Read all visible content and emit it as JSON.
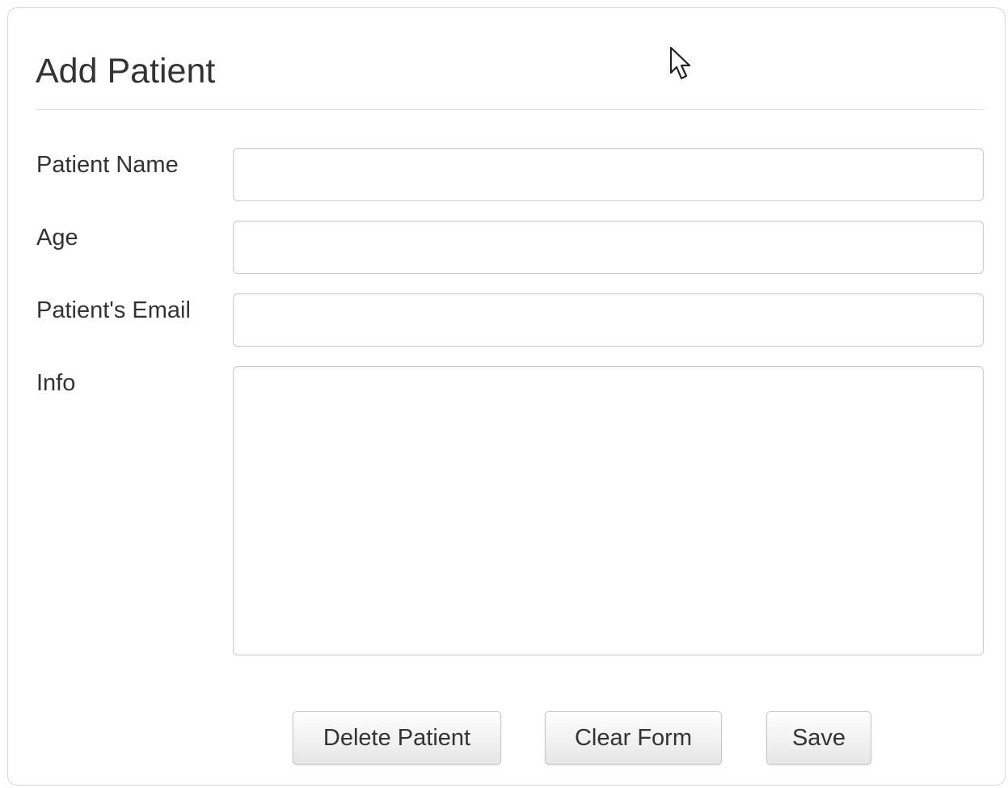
{
  "form": {
    "title": "Add Patient",
    "fields": [
      {
        "label": "Patient Name",
        "value": "",
        "placeholder": ""
      },
      {
        "label": "Age",
        "value": "",
        "placeholder": ""
      },
      {
        "label": "Patient's Email",
        "value": "",
        "placeholder": ""
      },
      {
        "label": "Info",
        "value": "",
        "placeholder": ""
      }
    ],
    "buttons": {
      "delete_label": "Delete Patient",
      "clear_label": "Clear Form",
      "save_label": "Save"
    }
  },
  "cursor": {
    "icon": "mouse-pointer-icon"
  }
}
